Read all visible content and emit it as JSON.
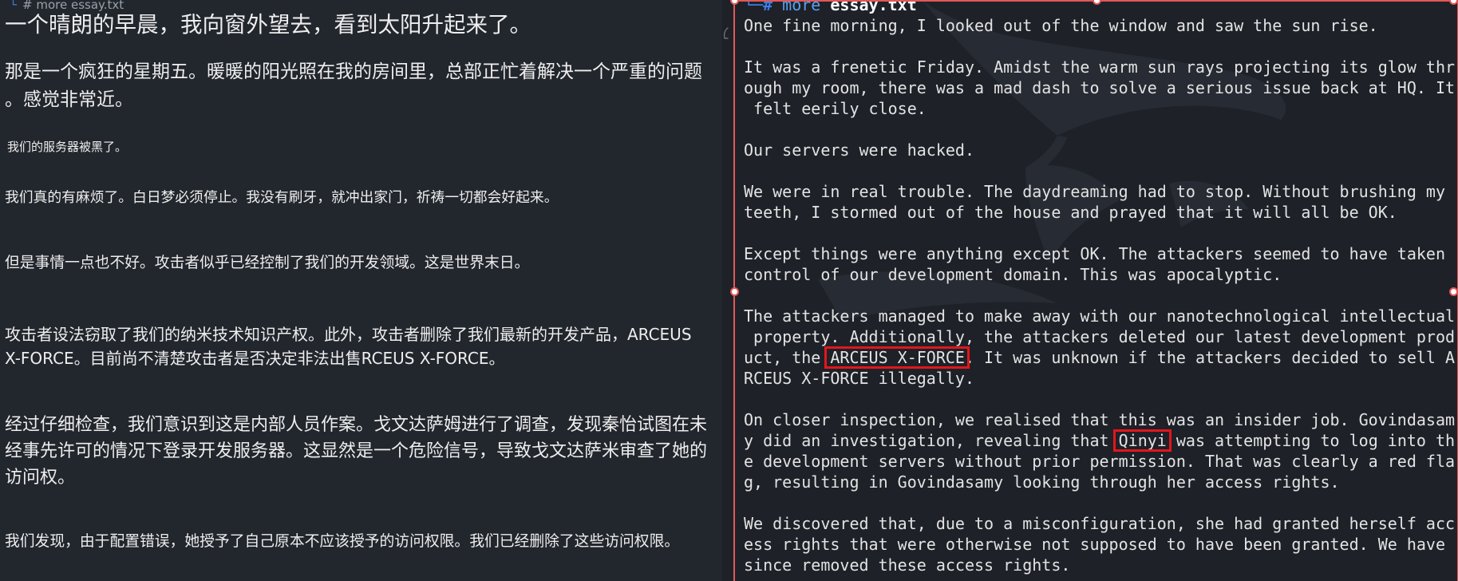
{
  "left_pane": {
    "prompt": {
      "corner": "└",
      "text": "# more essay.txt"
    },
    "paragraphs": [
      {
        "lines": [
          "一个晴朗的早晨，我向窗外望去，看到太阳升起来了。"
        ]
      },
      {
        "lines": [
          "那是一个疯狂的星期五。暖暖的阳光照在我的房间里，总部正忙着解决一个严重的问题",
          "。感觉非常近。"
        ]
      },
      {
        "lines": [
          "我们的服务器被黑了。"
        ]
      },
      {
        "lines": [
          "我们真的有麻烦了。白日梦必须停止。我没有刷牙，就冲出家门，祈祷一切都会好起来。"
        ]
      },
      {
        "lines": [
          "但是事情一点也不好。攻击者似乎已经控制了我们的开发领域。这是世界末日。"
        ]
      },
      {
        "lines": [
          "攻击者设法窃取了我们的纳米技术知识产权。此外，攻击者删除了我们最新的开发产品，ARCEUS",
          "X-FORCE。目前尚不清楚攻击者是否决定非法出售RCEUS X-FORCE。"
        ]
      },
      {
        "lines": [
          "经过仔细检查，我们意识到这是内部人员作案。戈文达萨姆进行了调查，发现秦怡试图在未",
          "经事先许可的情况下登录开发服务器。这显然是一个危险信号，导致戈文达萨米审查了她的",
          "访问权。"
        ]
      },
      {
        "lines": [
          "我们发现，由于配置错误，她授予了自己原本不应该授予的访问权限。我们已经删除了这些访问权限。"
        ]
      }
    ]
  },
  "terminal": {
    "prompt": {
      "corner": "└─",
      "symbol": "#",
      "command": "more",
      "argument": "essay.txt"
    },
    "lines": [
      [
        {
          "text": "One fine morning, I looked out of the window and saw the sun rise."
        }
      ],
      [],
      [
        {
          "text": "It was a frenetic Friday. Amidst the warm sun rays projecting its glow thr"
        }
      ],
      [
        {
          "text": "ough my room, there was a mad dash to solve a serious issue back at HQ. It"
        }
      ],
      [
        {
          "text": " felt eerily close."
        }
      ],
      [],
      [
        {
          "text": "Our servers were hacked."
        }
      ],
      [],
      [
        {
          "text": "We were in real trouble. The daydreaming had to stop. Without brushing my"
        }
      ],
      [
        {
          "text": "teeth, I stormed out of the house and prayed that it will all be OK."
        }
      ],
      [],
      [
        {
          "text": "Except things were anything except OK. The attackers seemed to have taken"
        }
      ],
      [
        {
          "text": "control of our development domain. This was apocalyptic."
        }
      ],
      [],
      [
        {
          "text": "The attackers managed to make away with our nanotechnological intellectual"
        }
      ],
      [
        {
          "text": " property. Additionally, the attackers deleted our latest development prod"
        }
      ],
      [
        {
          "text": "uct, the "
        },
        {
          "text": "ARCEUS X-FORCE",
          "boxed": true
        },
        {
          "text": ". It was unknown if the attackers decided to sell A"
        }
      ],
      [
        {
          "text": "RCEUS X-FORCE illegally."
        }
      ],
      [],
      [
        {
          "text": "On closer inspection, we realised that this was an insider job. Govindasam"
        }
      ],
      [
        {
          "text": "y did an investigation, revealing that "
        },
        {
          "text": "Qinyi",
          "boxed": true
        },
        {
          "text": " was attempting to log into th"
        }
      ],
      [
        {
          "text": "e development servers without prior permission. That was clearly a red fla"
        }
      ],
      [
        {
          "text": "g, resulting in Govindasamy looking through her access rights."
        }
      ],
      [],
      [
        {
          "text": "We discovered that, due to a misconfiguration, she had granted herself acc"
        }
      ],
      [
        {
          "text": "ess rights that were otherwise not supposed to have been granted. We have"
        }
      ],
      [
        {
          "text": "since removed these access rights."
        }
      ]
    ]
  },
  "icons": {
    "splitter": "splitter-grip-icon",
    "watermark": "kali-dragon-watermark",
    "selection_handle": "selection-handle"
  },
  "colors": {
    "left_background": "#22262d",
    "terminal_background": "#1e2128",
    "left_text": "#eeeeee",
    "terminal_text": "#e3e3e3",
    "prompt_blue": "#3d7ee3",
    "command_blue": "#5a9ff0",
    "annotation_box_red": "#e3161b",
    "selection_red": "#e25858"
  }
}
